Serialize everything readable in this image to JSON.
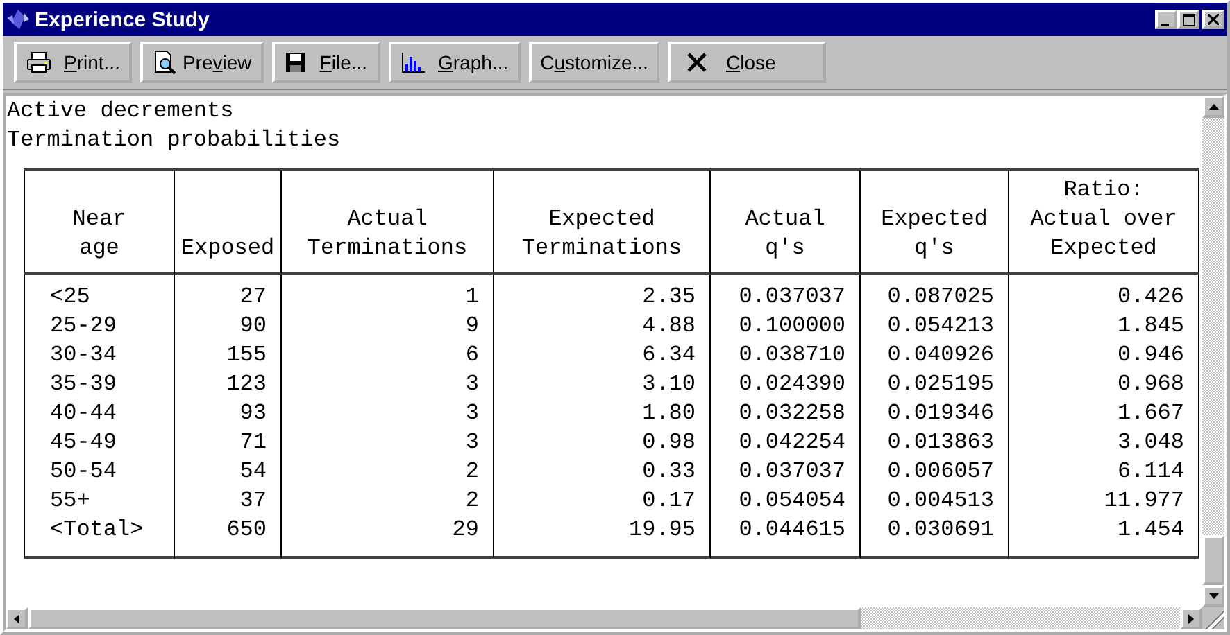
{
  "window": {
    "title": "Experience Study"
  },
  "toolbar": [
    {
      "kind": "print",
      "label": {
        "key": "P",
        "after": "rint..."
      }
    },
    {
      "kind": "preview",
      "label": {
        "before": "Pre",
        "key": "v",
        "after": "iew"
      }
    },
    {
      "kind": "file",
      "label": {
        "key": "F",
        "after": "ile..."
      }
    },
    {
      "kind": "graph",
      "label": {
        "key": "G",
        "after": "raph..."
      }
    },
    {
      "kind": "plain",
      "label": {
        "before": "C",
        "key": "u",
        "after": "stomize..."
      }
    },
    {
      "kind": "close",
      "label": {
        "key": "C",
        "after": "lose"
      }
    }
  ],
  "report": {
    "lines": [
      "Active decrements",
      "Termination probabilities"
    ],
    "table": {
      "columns": [
        "Near\nage",
        "Exposed",
        "Actual\nTerminations",
        "Expected\nTerminations",
        "Actual\nq's",
        "Expected\nq's",
        "Ratio:\nActual over\nExpected"
      ],
      "rows": [
        [
          "<25",
          "27",
          "1",
          "2.35",
          "0.037037",
          "0.087025",
          "0.426"
        ],
        [
          "25-29",
          "90",
          "9",
          "4.88",
          "0.100000",
          "0.054213",
          "1.845"
        ],
        [
          "30-34",
          "155",
          "6",
          "6.34",
          "0.038710",
          "0.040926",
          "0.946"
        ],
        [
          "35-39",
          "123",
          "3",
          "3.10",
          "0.024390",
          "0.025195",
          "0.968"
        ],
        [
          "40-44",
          "93",
          "3",
          "1.80",
          "0.032258",
          "0.019346",
          "1.667"
        ],
        [
          "45-49",
          "71",
          "3",
          "0.98",
          "0.042254",
          "0.013863",
          "3.048"
        ],
        [
          "50-54",
          "54",
          "2",
          "0.33",
          "0.037037",
          "0.006057",
          "6.114"
        ],
        [
          "55+",
          "37",
          "2",
          "0.17",
          "0.054054",
          "0.004513",
          "11.977"
        ],
        [
          "<Total>",
          "650",
          "29",
          "19.95",
          "0.044615",
          "0.030691",
          "1.454"
        ]
      ]
    }
  }
}
